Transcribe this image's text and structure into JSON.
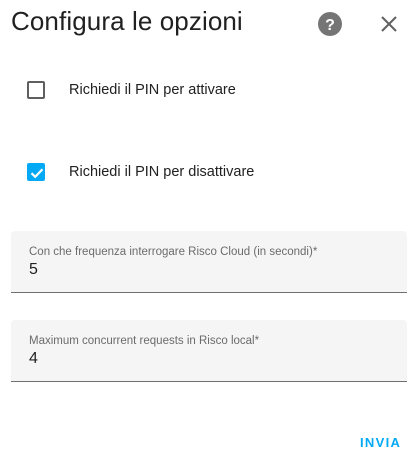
{
  "dialog": {
    "title": "Configura le opzioni",
    "help_icon": "help-circle-icon",
    "close_icon": "close-icon"
  },
  "options": [
    {
      "label": "Richiedi il PIN per attivare",
      "checked": false
    },
    {
      "label": "Richiedi il PIN per disattivare",
      "checked": true
    }
  ],
  "fields": [
    {
      "label": "Con che frequenza interrogare Risco Cloud (in secondi)*",
      "value": "5"
    },
    {
      "label": "Maximum concurrent requests in Risco local*",
      "value": "4"
    }
  ],
  "actions": {
    "submit_label": "INVIA"
  },
  "colors": {
    "accent": "#03a9f4",
    "text": "#212121",
    "icon": "#757575",
    "field_bg": "#f5f5f5"
  }
}
